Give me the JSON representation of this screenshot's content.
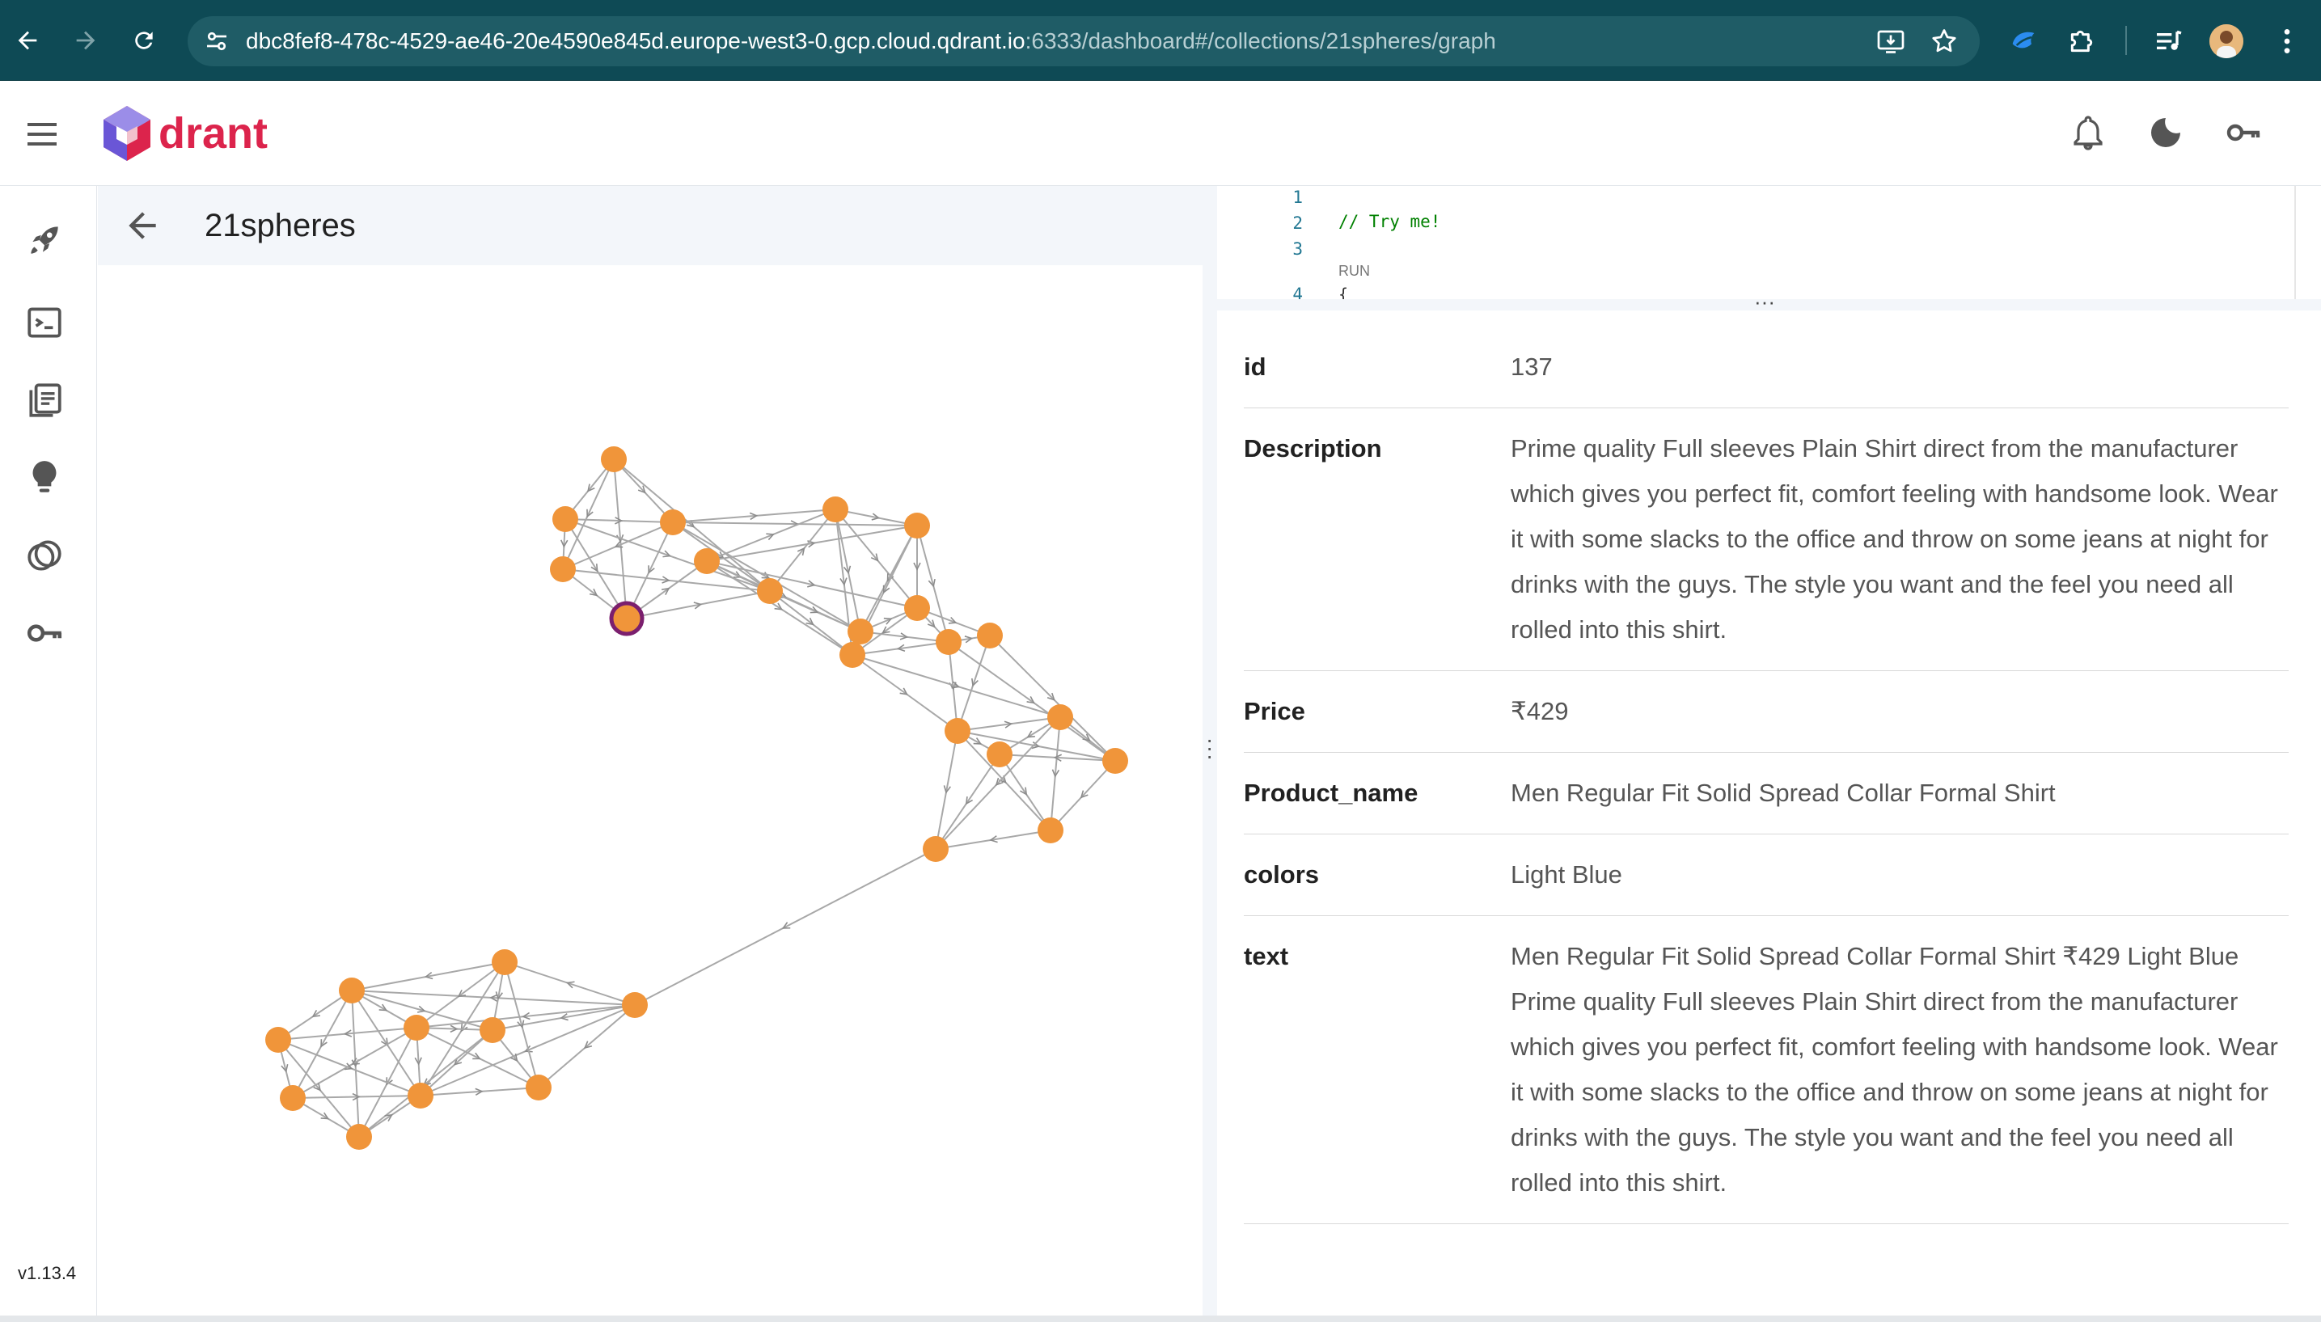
{
  "browser": {
    "url_host": "dbc8fef8-478c-4529-ae46-20e4590e845d.europe-west3-0.gcp.cloud.qdrant.io",
    "url_path": ":6333/dashboard#/collections/21spheres/graph"
  },
  "app": {
    "logo_text": "drant",
    "version": "v1.13.4",
    "accent": "#dc244c"
  },
  "collection": {
    "title": "21spheres"
  },
  "editor": {
    "lines": [
      "1",
      "2",
      "3",
      "4"
    ],
    "comment": "// Try me!",
    "run_label": "RUN",
    "brace": "{"
  },
  "point": {
    "fields": [
      {
        "key": "id",
        "value": "137"
      },
      {
        "key": "Description",
        "value": "Prime quality Full sleeves Plain Shirt direct from the manufacturer which gives you perfect fit, comfort feeling with handsome look. Wear it with some slacks to the office and throw on some jeans at night for drinks with the guys. The style you want and the feel you need all rolled into this shirt."
      },
      {
        "key": "Price",
        "value": "₹429"
      },
      {
        "key": "Product_name",
        "value": "Men Regular Fit Solid Spread Collar Formal Shirt"
      },
      {
        "key": "colors",
        "value": "Light Blue"
      },
      {
        "key": "text",
        "value": "Men Regular Fit Solid Spread Collar Formal Shirt ₹429 Light Blue Prime quality Full sleeves Plain Shirt direct from the manufacturer which gives you perfect fit, comfort feeling with handsome look. Wear it with some slacks to the office and throw on some jeans at night for drinks with the guys. The style you want and the feel you need all rolled into this shirt."
      }
    ]
  },
  "graph": {
    "node_color": "#f0953a",
    "selected_stroke": "#7b1f6e",
    "edge_color": "#a8a8a8",
    "selected_node": "n5"
  },
  "icons": {
    "browser": [
      "back-arrow-icon",
      "forward-arrow-icon",
      "reload-icon",
      "site-info-icon",
      "install-app-icon",
      "bookmark-star-icon",
      "extension-icon",
      "puzzle-icon",
      "media-control-icon",
      "more-vert-icon"
    ],
    "header": [
      "hamburger-menu-icon",
      "bell-icon",
      "dark-mode-icon",
      "api-key-icon"
    ],
    "sidebar": [
      "rocket-icon",
      "console-icon",
      "collections-icon",
      "tutorial-lightbulb-icon",
      "datasets-icon",
      "access-key-icon"
    ]
  }
}
